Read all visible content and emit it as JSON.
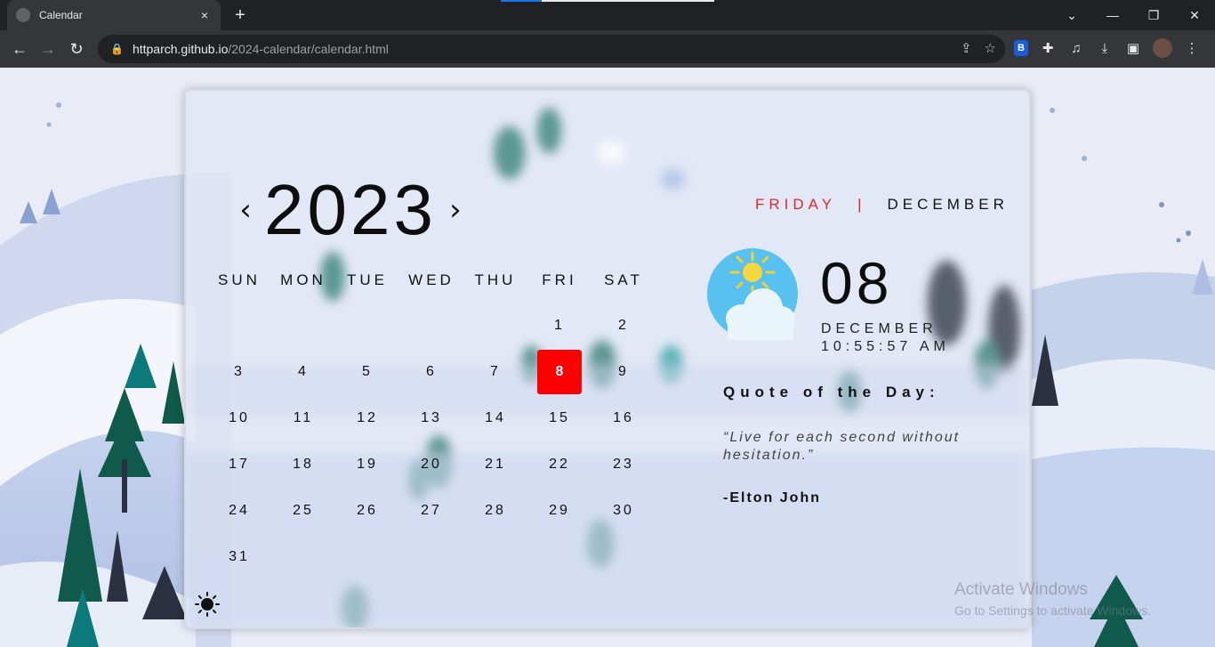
{
  "browser": {
    "tab_title": "Calendar",
    "tab_close": "×",
    "new_tab": "+",
    "url_host": "httparch.github.io",
    "url_path": "/2024-calendar/calendar.html",
    "window_controls": [
      "⌄",
      "—",
      "❐",
      "✕"
    ],
    "nav": {
      "back": "←",
      "forward": "→",
      "reload": "↻"
    }
  },
  "calendar": {
    "prev_label": "‹",
    "next_label": "›",
    "year": "2023",
    "weekdays": [
      "SUN",
      "MON",
      "TUE",
      "WED",
      "THU",
      "FRI",
      "SAT"
    ],
    "days": [
      "",
      "",
      "",
      "",
      "",
      "1",
      "2",
      "3",
      "4",
      "5",
      "6",
      "7",
      "8",
      "9",
      "10",
      "11",
      "12",
      "13",
      "14",
      "15",
      "16",
      "17",
      "18",
      "19",
      "20",
      "21",
      "22",
      "23",
      "24",
      "25",
      "26",
      "27",
      "28",
      "29",
      "30",
      "31",
      "",
      "",
      "",
      "",
      "",
      ""
    ],
    "today": "8"
  },
  "sidebar": {
    "day_name": "FRIDAY",
    "separator": "|",
    "month_name": "DECEMBER",
    "date_number": "08",
    "month_small": "DECEMBER",
    "time": "10:55:57 AM",
    "quote_title": "Quote of the Day:",
    "quote_text": "“Live for each second without hesitation.”",
    "quote_author": "-Elton John"
  },
  "watermark": {
    "line1": "Activate Windows",
    "line2": "Go to Settings to activate Windows."
  },
  "colors": {
    "accent": "#ff0000",
    "day_name": "#e6242a"
  },
  "icons": {
    "weather": "sun-cloud-icon",
    "theme_toggle": "sun-icon"
  }
}
